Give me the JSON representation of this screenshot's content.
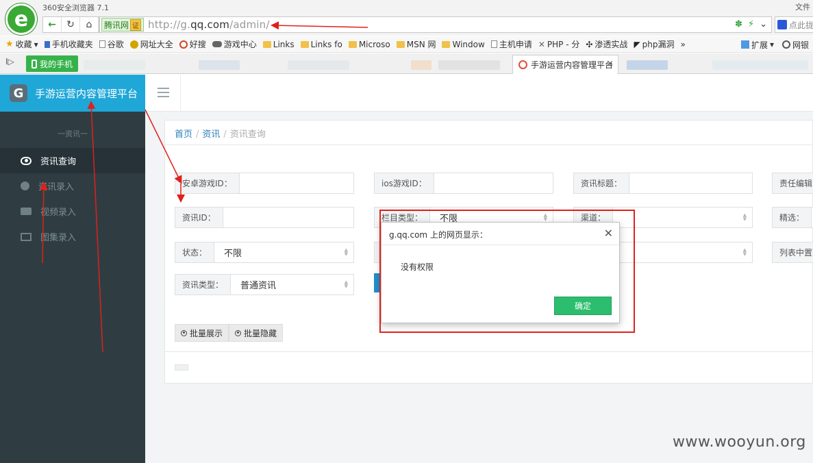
{
  "browser": {
    "title": "360安全浏览器 7.1",
    "title_right": "文件",
    "logo_letter": "e",
    "cert_name": "腾讯网",
    "cert_badge": "证",
    "url_prefix": "http://g.",
    "url_domain": "qq.com",
    "url_path": "/admin/",
    "search_placeholder": "点此拢",
    "bookmarks": [
      "收藏",
      "手机收藏夹",
      "谷歌",
      "网址大全",
      "好搜",
      "游戏中心",
      "Links",
      "Links fo",
      "Microso",
      "MSN 网",
      "Window",
      "主机申请",
      "PHP - 分",
      "渗透实战",
      "php漏洞",
      "»"
    ],
    "bm_extend": "扩展",
    "bm_bank": "网银",
    "my_phone": "我的手机",
    "active_tab": "手游运营内容管理平台"
  },
  "sidebar": {
    "brand_title": "手游运营内容管理平台",
    "section": "一资讯一",
    "items": [
      {
        "label": "资讯查询",
        "icon": "eye-icon",
        "active": true
      },
      {
        "label": "资讯录入",
        "icon": "info-icon",
        "active": false
      },
      {
        "label": "视频录入",
        "icon": "video-icon",
        "active": false
      },
      {
        "label": "图集录入",
        "icon": "image-icon",
        "active": false
      }
    ]
  },
  "breadcrumb": {
    "home": "首页",
    "section": "资讯",
    "current": "资讯查询"
  },
  "filters": {
    "android_id_label": "安卓游戏ID：",
    "ios_id_label": "ios游戏ID：",
    "title_label": "资讯标题：",
    "editor_label": "责任编辑",
    "news_id_label": "资讯ID：",
    "column_type_label": "栏目类型：",
    "column_type_value": "不限",
    "channel_label": "渠道：",
    "featured_label": "精选：",
    "status_label": "状态：",
    "status_value": "不限",
    "fourth_value": "不限",
    "list_top_label": "列表中置顶",
    "news_type_label": "资讯类型：",
    "news_type_value": "普通资讯"
  },
  "batch": {
    "show": "批量展示",
    "hide": "批量隐藏"
  },
  "dialog": {
    "title": "g.qq.com 上的网页显示：",
    "message": "没有权限",
    "ok": "确定"
  },
  "watermark": "www.wooyun.org",
  "colors": {
    "brand": "#1fa7d8",
    "sidebar": "#2f3d43",
    "ok_button": "#2dbd6e",
    "annotation": "#e0201b"
  }
}
